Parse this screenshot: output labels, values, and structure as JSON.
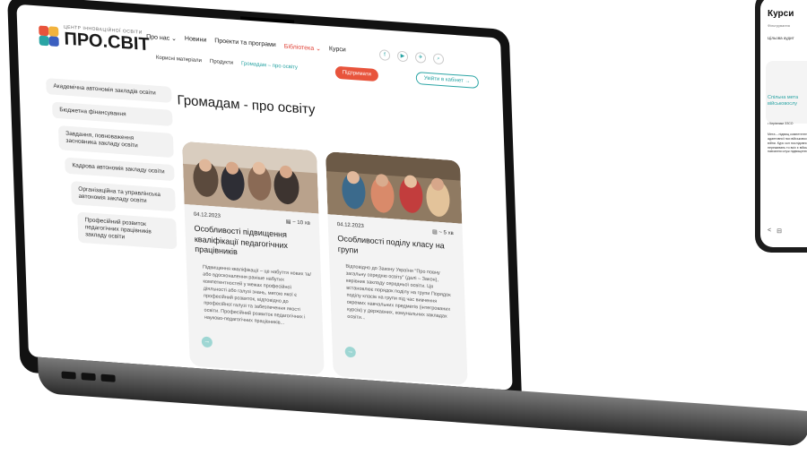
{
  "site": {
    "logo_tag": "ЦЕНТР ІННОВАЦІЙНОЇ ОСВІТИ",
    "logo_name": "ПРО.СВІТ"
  },
  "nav": {
    "items": [
      "Про нас ⌄",
      "Новини",
      "Проекти та програми",
      "Бібліотека ⌄",
      "Курси"
    ],
    "active_index": 3
  },
  "subnav": {
    "items": [
      "Корисні матеріали",
      "Продукти",
      "Громадам – про освіту"
    ],
    "current_index": 2
  },
  "socials": {
    "icons": [
      "facebook-icon",
      "youtube-icon",
      "telegram-icon",
      "search-icon"
    ],
    "glyphs": [
      "f",
      "▶",
      "✈",
      "⌕"
    ]
  },
  "header_buttons": {
    "support_label": "Підтримати",
    "cabinet_label": "Увійти в кабінет →"
  },
  "sidebar": {
    "items": [
      "Академічна автономія закладів освіти",
      "Бюджетна фінансування",
      "Завдання, повноваження засновника закладу освіти",
      "Кадрова автономія закладу освіти",
      "Організаційна та управлінська автономія закладу освіти",
      "Професійний розвиток педагогічних працівників закладу освіти"
    ]
  },
  "page": {
    "title": "Громадам - про освіту"
  },
  "cards": [
    {
      "date": "04.12.2023",
      "read_time": "▤ ~ 10 хв",
      "title": "Особливості підвищення кваліфікації педагогічних працівників",
      "excerpt": "Підвищення кваліфікації – це набуття нових та/ або вдосконалення раніше набутих компетентностей у межах професійної діяльності або галузі знань, метою якої є професійний розвиток, відповідно до професійної галузі та забезпечення якості освіти. Професійний розвиток педагогічних і науково-педагогічних працівників..."
    },
    {
      "date": "04.12.2023",
      "read_time": "▤ ~ 5 хв",
      "title": "Особливості поділу класу на групи",
      "excerpt": "Відповідно до Закону України \"Про повну загальну середню освіту\" (далі – Закон), керівник закладу середньої освіти. Ця встановлює порядок поділу на групи Порядок поділу класів на групи під час вивчення окремих навчальних предметів (інтегрованих курсів) у державних, комунальних закладах освіти..."
    }
  ],
  "phone": {
    "title": "Курси",
    "subtitle": "Фільтрування",
    "filter": "Цільова аудит",
    "card_title": "Спільна мета військовослу",
    "tag": "• Керівники ЗЗСО",
    "body": "Мета – підвищ компетентност адаптивної пси військовослужб війни. Курс скл послідовно роз переживань то всіх є військово навчання служ підвищення кв",
    "nav": [
      "<",
      "⊟"
    ]
  },
  "colors": {
    "accent": "#e8543c",
    "teal": "#2aa4a4",
    "card_bg": "#f3f3f3"
  }
}
